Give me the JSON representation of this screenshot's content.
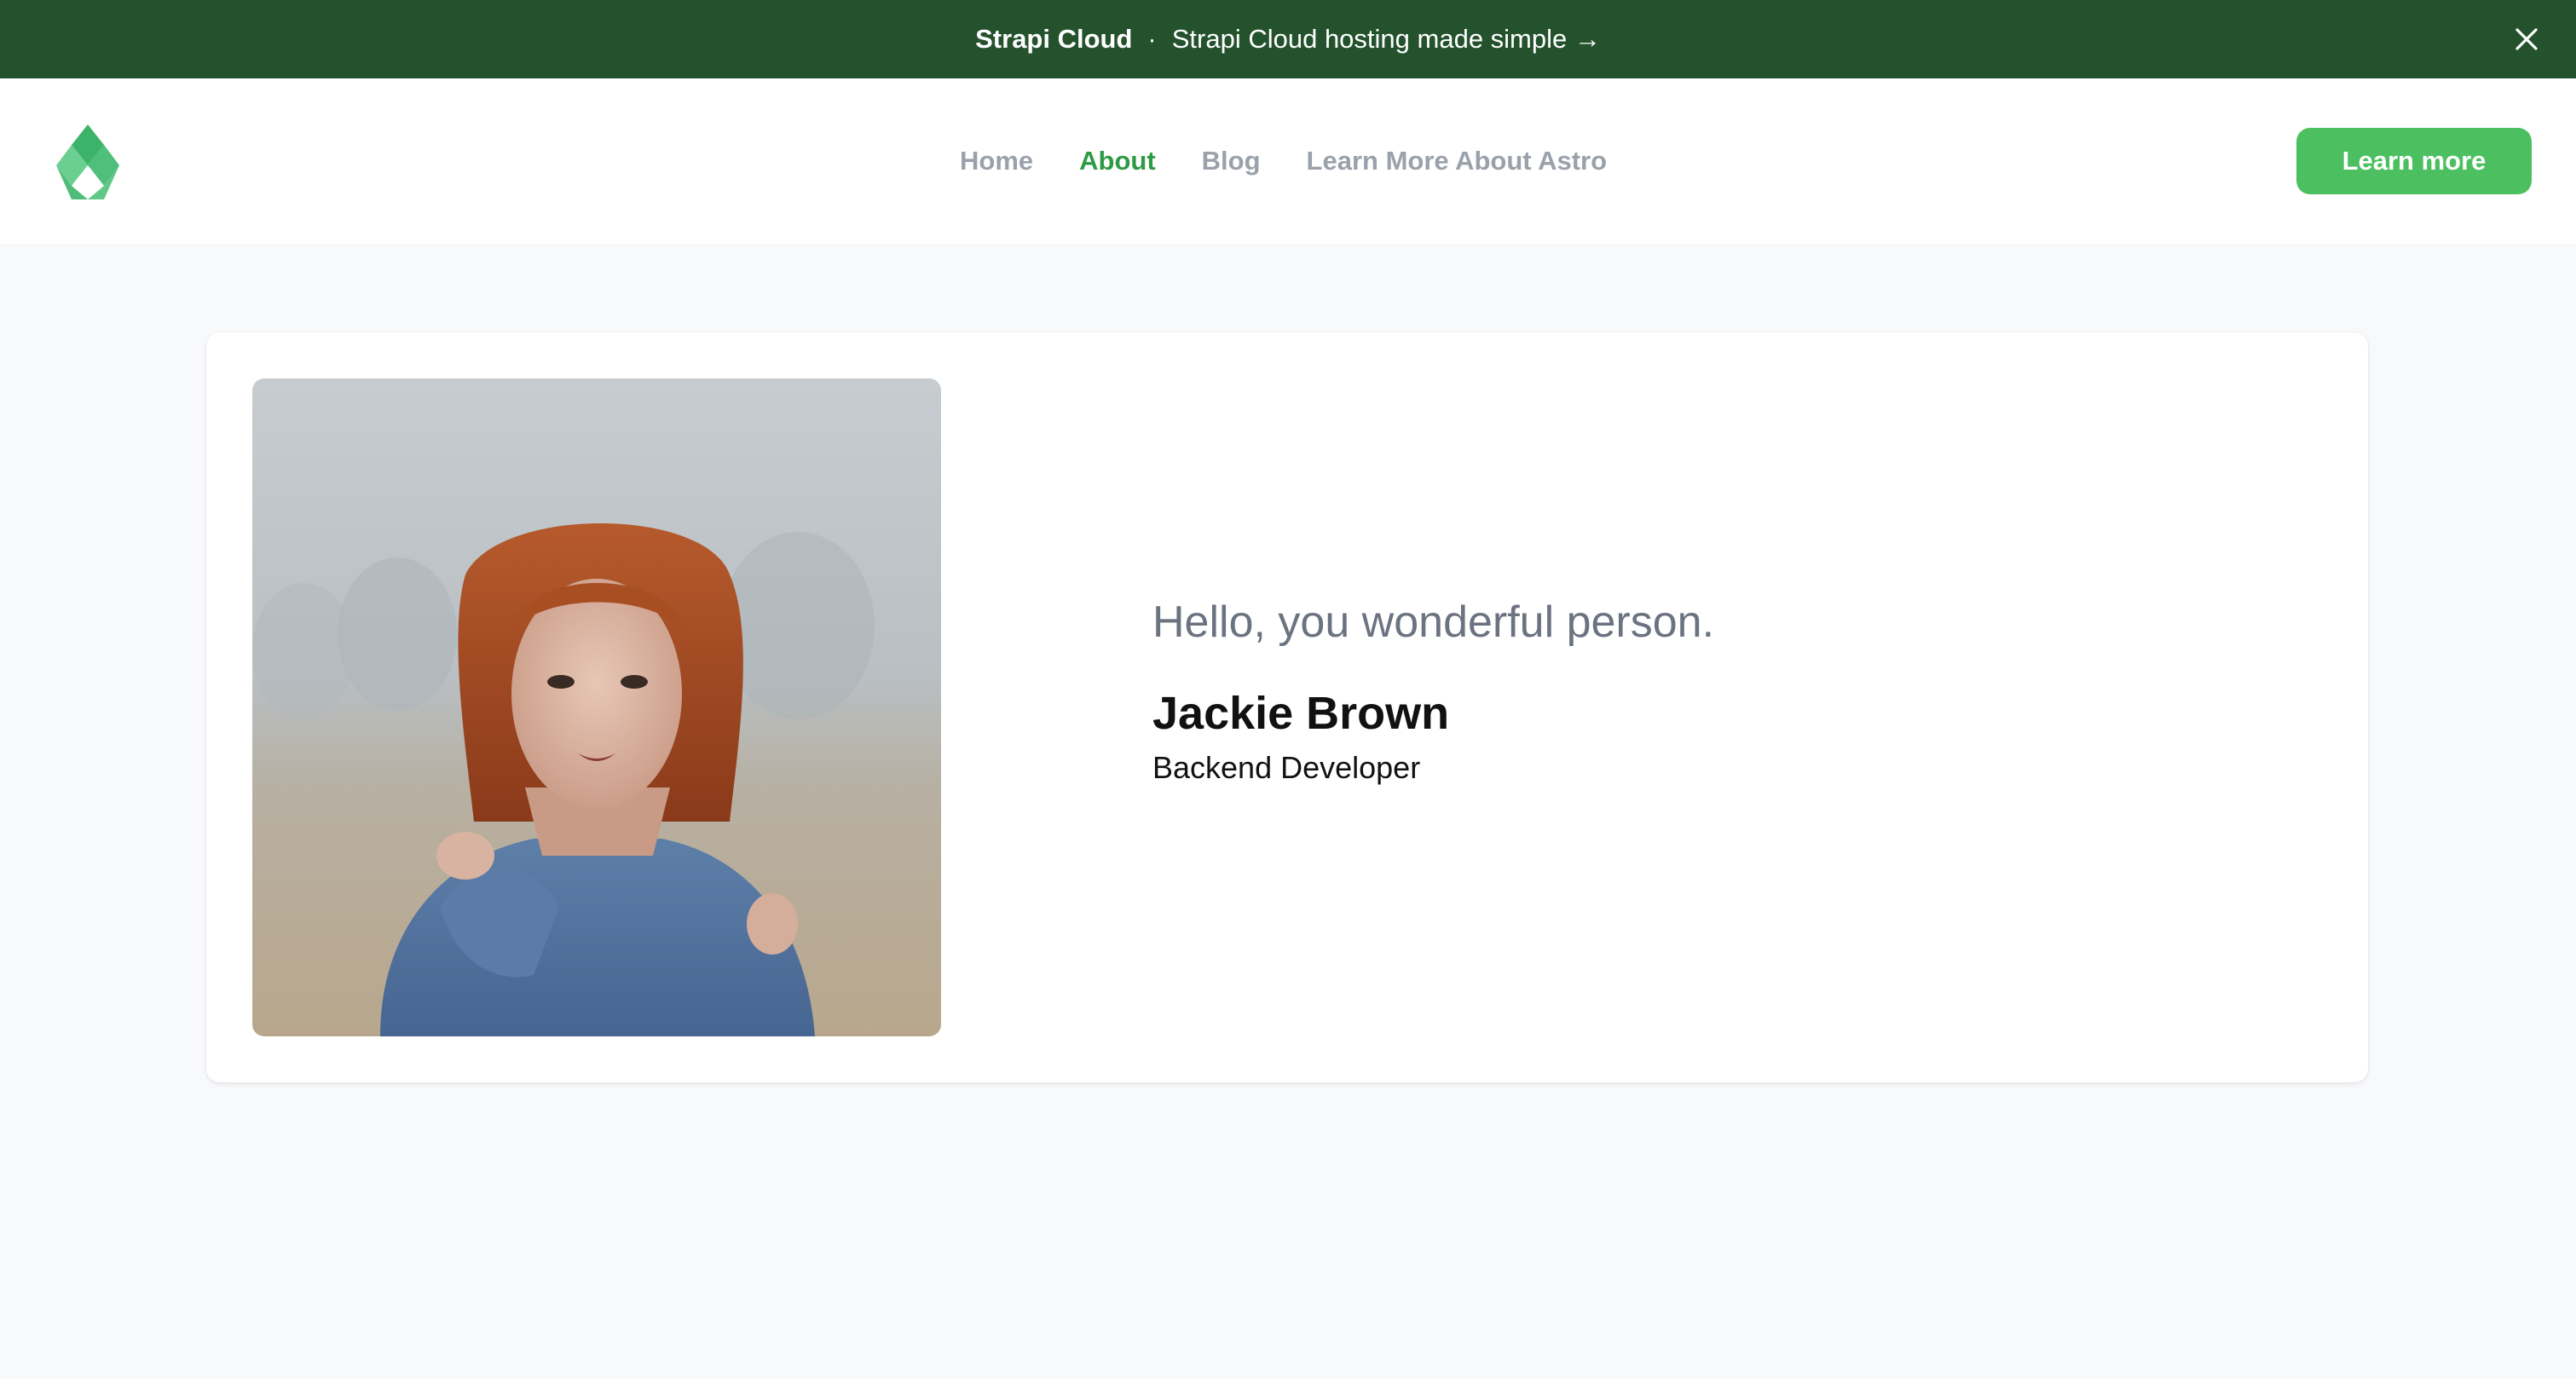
{
  "banner": {
    "brand": "Strapi Cloud",
    "separator": "·",
    "message": "Strapi Cloud hosting made simple →",
    "close_icon": "close-icon"
  },
  "header": {
    "logo_icon": "diamond-logo-icon",
    "nav": [
      {
        "label": "Home",
        "active": false
      },
      {
        "label": "About",
        "active": true
      },
      {
        "label": "Blog",
        "active": false
      },
      {
        "label": "Learn More About Astro",
        "active": false
      }
    ],
    "cta_label": "Learn more"
  },
  "profile": {
    "greeting": "Hello, you wonderful person.",
    "name": "Jackie Brown",
    "role": "Backend Developer"
  },
  "colors": {
    "banner_bg": "#24522d",
    "accent": "#2f9a45",
    "button_bg": "#4cc061",
    "page_bg": "#f8f9fb"
  }
}
